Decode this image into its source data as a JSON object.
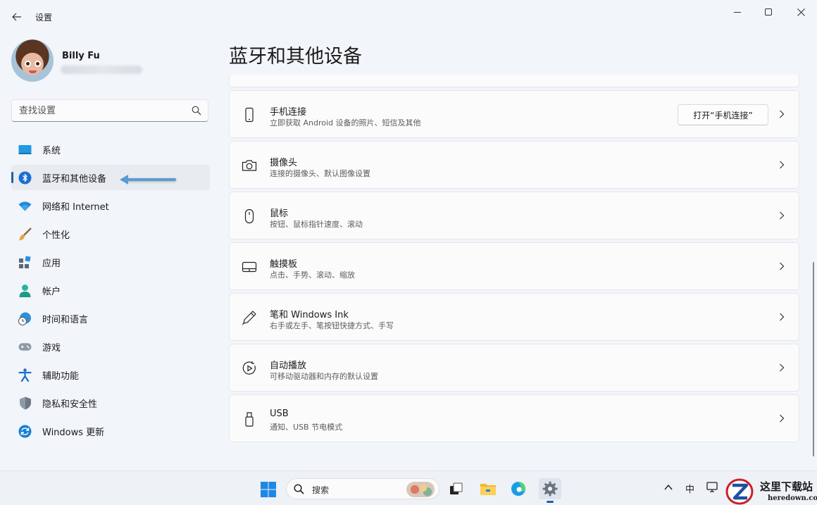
{
  "window": {
    "title": "设置",
    "back_icon": "arrow-left-icon",
    "controls": [
      "minimize-icon",
      "maximize-icon",
      "close-icon"
    ]
  },
  "user": {
    "name": "Billy Fu"
  },
  "search": {
    "placeholder": "查找设置"
  },
  "sidebar": {
    "items": [
      {
        "label": "系统",
        "icon": "system-icon",
        "active": false
      },
      {
        "label": "蓝牙和其他设备",
        "icon": "bluetooth-icon",
        "active": true
      },
      {
        "label": "网络和 Internet",
        "icon": "wifi-icon",
        "active": false
      },
      {
        "label": "个性化",
        "icon": "brush-icon",
        "active": false
      },
      {
        "label": "应用",
        "icon": "apps-icon",
        "active": false
      },
      {
        "label": "帐户",
        "icon": "account-icon",
        "active": false
      },
      {
        "label": "时间和语言",
        "icon": "globe-clock-icon",
        "active": false
      },
      {
        "label": "游戏",
        "icon": "gamepad-icon",
        "active": false
      },
      {
        "label": "辅助功能",
        "icon": "accessibility-icon",
        "active": false
      },
      {
        "label": "隐私和安全性",
        "icon": "shield-icon",
        "active": false
      },
      {
        "label": "Windows 更新",
        "icon": "update-icon",
        "active": false
      }
    ]
  },
  "main": {
    "title": "蓝牙和其他设备",
    "cards": [
      {
        "title": "手机连接",
        "subtitle": "立即获取 Android 设备的照片、短信及其他",
        "icon": "phone-icon",
        "button": "打开“手机连接”"
      },
      {
        "title": "摄像头",
        "subtitle": "连接的摄像头、默认图像设置",
        "icon": "camera-icon"
      },
      {
        "title": "鼠标",
        "subtitle": "按钮、鼠标指针速度、滚动",
        "icon": "mouse-icon"
      },
      {
        "title": "触摸板",
        "subtitle": "点击、手势、滚动、缩放",
        "icon": "touchpad-icon"
      },
      {
        "title": "笔和 Windows Ink",
        "subtitle": "右手或左手、笔按钮快捷方式、手写",
        "icon": "pen-icon"
      },
      {
        "title": "自动播放",
        "subtitle": "可移动驱动器和内存的默认设置",
        "icon": "autoplay-icon"
      },
      {
        "title": "USB",
        "subtitle": "通知、USB 节电模式",
        "icon": "usb-icon"
      }
    ]
  },
  "taskbar": {
    "search_label": "搜索",
    "apps": [
      "windows-start-icon",
      "task-view-icon",
      "file-explorer-icon",
      "edge-browser-icon",
      "settings-gear-icon"
    ],
    "ime_label": "中"
  },
  "watermark": {
    "cn": "这里下载站",
    "en": "heredown.com"
  },
  "colors": {
    "accent": "#1a5fb4",
    "window_bg": "#f2f5fa",
    "card_bg": "#fbfbfc",
    "annotation_arrow": "#5b9bd5"
  }
}
